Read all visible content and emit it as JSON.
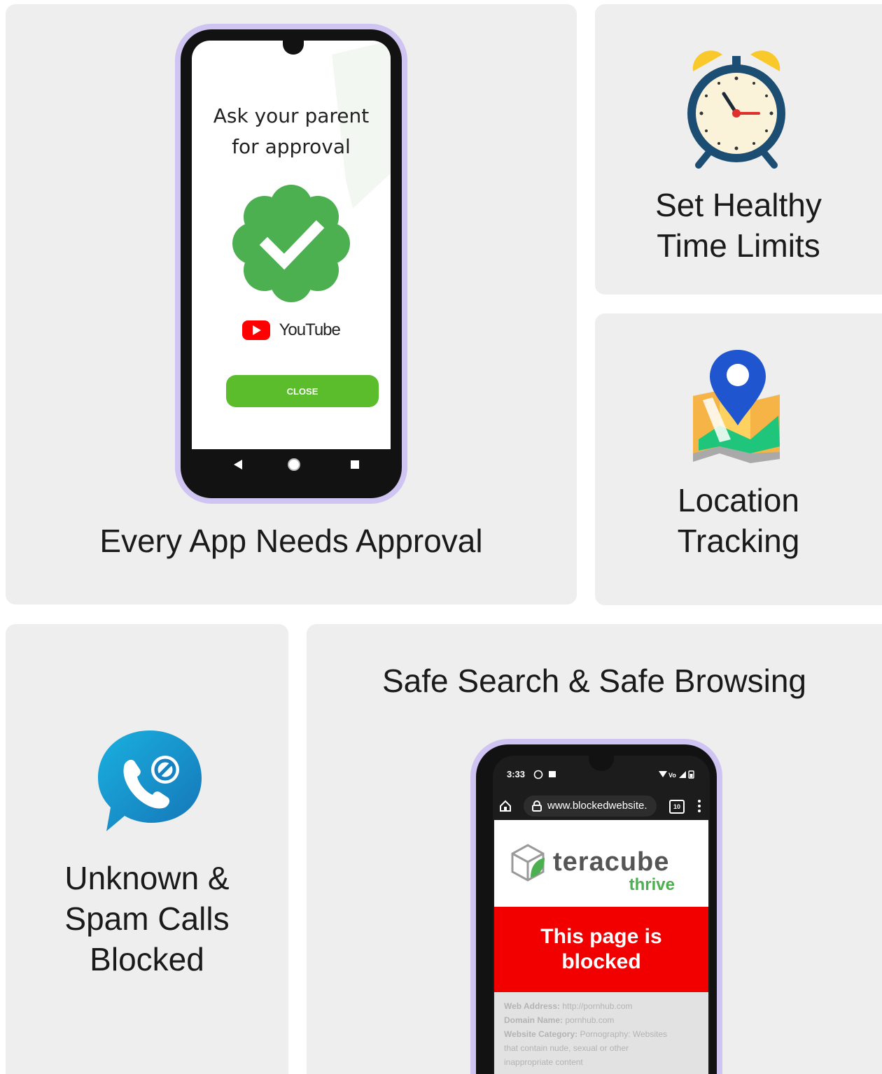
{
  "tiles": {
    "approval": {
      "caption": "Every App Needs Approval",
      "phone": {
        "prompt_line1": "Ask your parent",
        "prompt_line2": "for approval",
        "app_name": "YouTube",
        "close_label": "CLOSE"
      }
    },
    "time": {
      "caption_line1": "Set Healthy",
      "caption_line2": "Time Limits"
    },
    "location": {
      "caption_line1": "Location",
      "caption_line2": "Tracking"
    },
    "calls": {
      "caption_line1": "Unknown &",
      "caption_line2": "Spam Calls",
      "caption_line3": "Blocked"
    },
    "browse": {
      "caption": "Safe Search & Safe Browsing",
      "phone": {
        "time": "3:33",
        "url": "www.blockedwebsite.",
        "tab_count": "10",
        "brand": "teracube",
        "brand_sub": "thrive",
        "blocked_line1": "This page is",
        "blocked_line2": "blocked",
        "detail_rows": [
          {
            "label": "Web Address:",
            "value": "http://pornhub.com"
          },
          {
            "label": "Domain Name:",
            "value": "pornhub.com"
          },
          {
            "label": "Website Category:",
            "value": "Pornography: Websites"
          },
          {
            "label": "",
            "value": "that contain nude, sexual or other"
          },
          {
            "label": "",
            "value": "inappropriate content"
          }
        ]
      }
    }
  },
  "colors": {
    "tile_bg": "#eeeeee",
    "phone_frame": "#cfc4f2",
    "approve_green": "#4caf50",
    "button_green": "#5bbd2b",
    "block_red": "#f20000",
    "brand_gray": "#555555",
    "brand_green": "#4caf50"
  }
}
